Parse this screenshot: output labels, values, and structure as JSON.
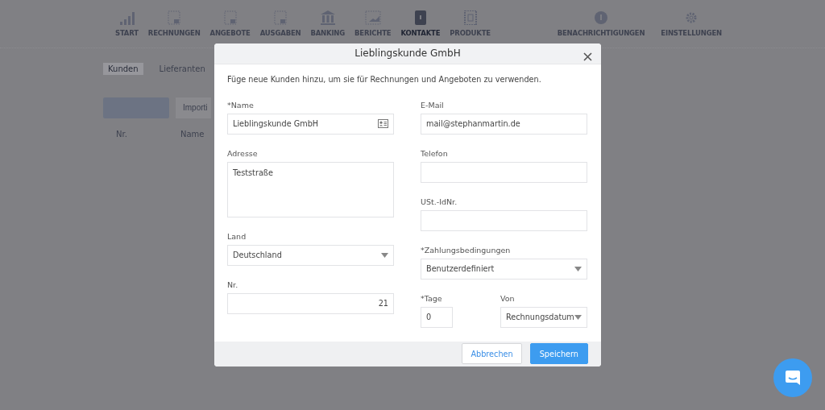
{
  "nav": [
    {
      "label": "START",
      "selected": false
    },
    {
      "label": "RECHNUNGEN",
      "selected": false
    },
    {
      "label": "ANGEBOTE",
      "selected": false
    },
    {
      "label": "AUSGABEN",
      "selected": false
    },
    {
      "label": "BANKING",
      "selected": false
    },
    {
      "label": "BERICHTE",
      "selected": false
    },
    {
      "label": "KONTAKTE",
      "selected": true
    },
    {
      "label": "PRODUKTE",
      "selected": false
    }
  ],
  "nav_right": [
    {
      "label": "BENACHRICHTIGUNGEN"
    },
    {
      "label": "EINSTELLUNGEN"
    }
  ],
  "subtabs": [
    {
      "label": "Kunden",
      "selected": true
    },
    {
      "label": "Lieferanten",
      "selected": false
    }
  ],
  "toolbar": {
    "import_button": "Importi"
  },
  "table": {
    "columns": [
      "Nr.",
      "Name"
    ]
  },
  "modal": {
    "title": "Lieblingskunde GmbH",
    "intro": "Füge neue Kunden hinzu, um sie für Rechnungen und Angeboten zu verwenden.",
    "left_fields": [
      {
        "kind": "card-text",
        "label": "*Name",
        "value": "Lieblingskunde GmbH"
      },
      {
        "kind": "textarea",
        "label": "Adresse",
        "value": "Teststraße"
      },
      {
        "kind": "select",
        "label": "Land",
        "value": "Deutschland"
      },
      {
        "kind": "number",
        "label": "Nr.",
        "value": "21"
      }
    ],
    "right_fields": [
      {
        "kind": "text",
        "label": "E-Mail",
        "value": "mail@stephanmartin.de"
      },
      {
        "kind": "text",
        "label": "Telefon"
      },
      {
        "kind": "text",
        "label": "USt.-IdNr."
      },
      {
        "kind": "select",
        "label": "*Zahlungsbedingungen",
        "value": "Benutzerdefiniert"
      }
    ],
    "terms_row": [
      {
        "kind": "text",
        "label": "*Tage",
        "value": "0"
      },
      {
        "kind": "select",
        "label": "Von",
        "value": "Rechnungsdatum"
      }
    ],
    "cancel_button": "Abbrechen",
    "save_button": "Speichern"
  }
}
